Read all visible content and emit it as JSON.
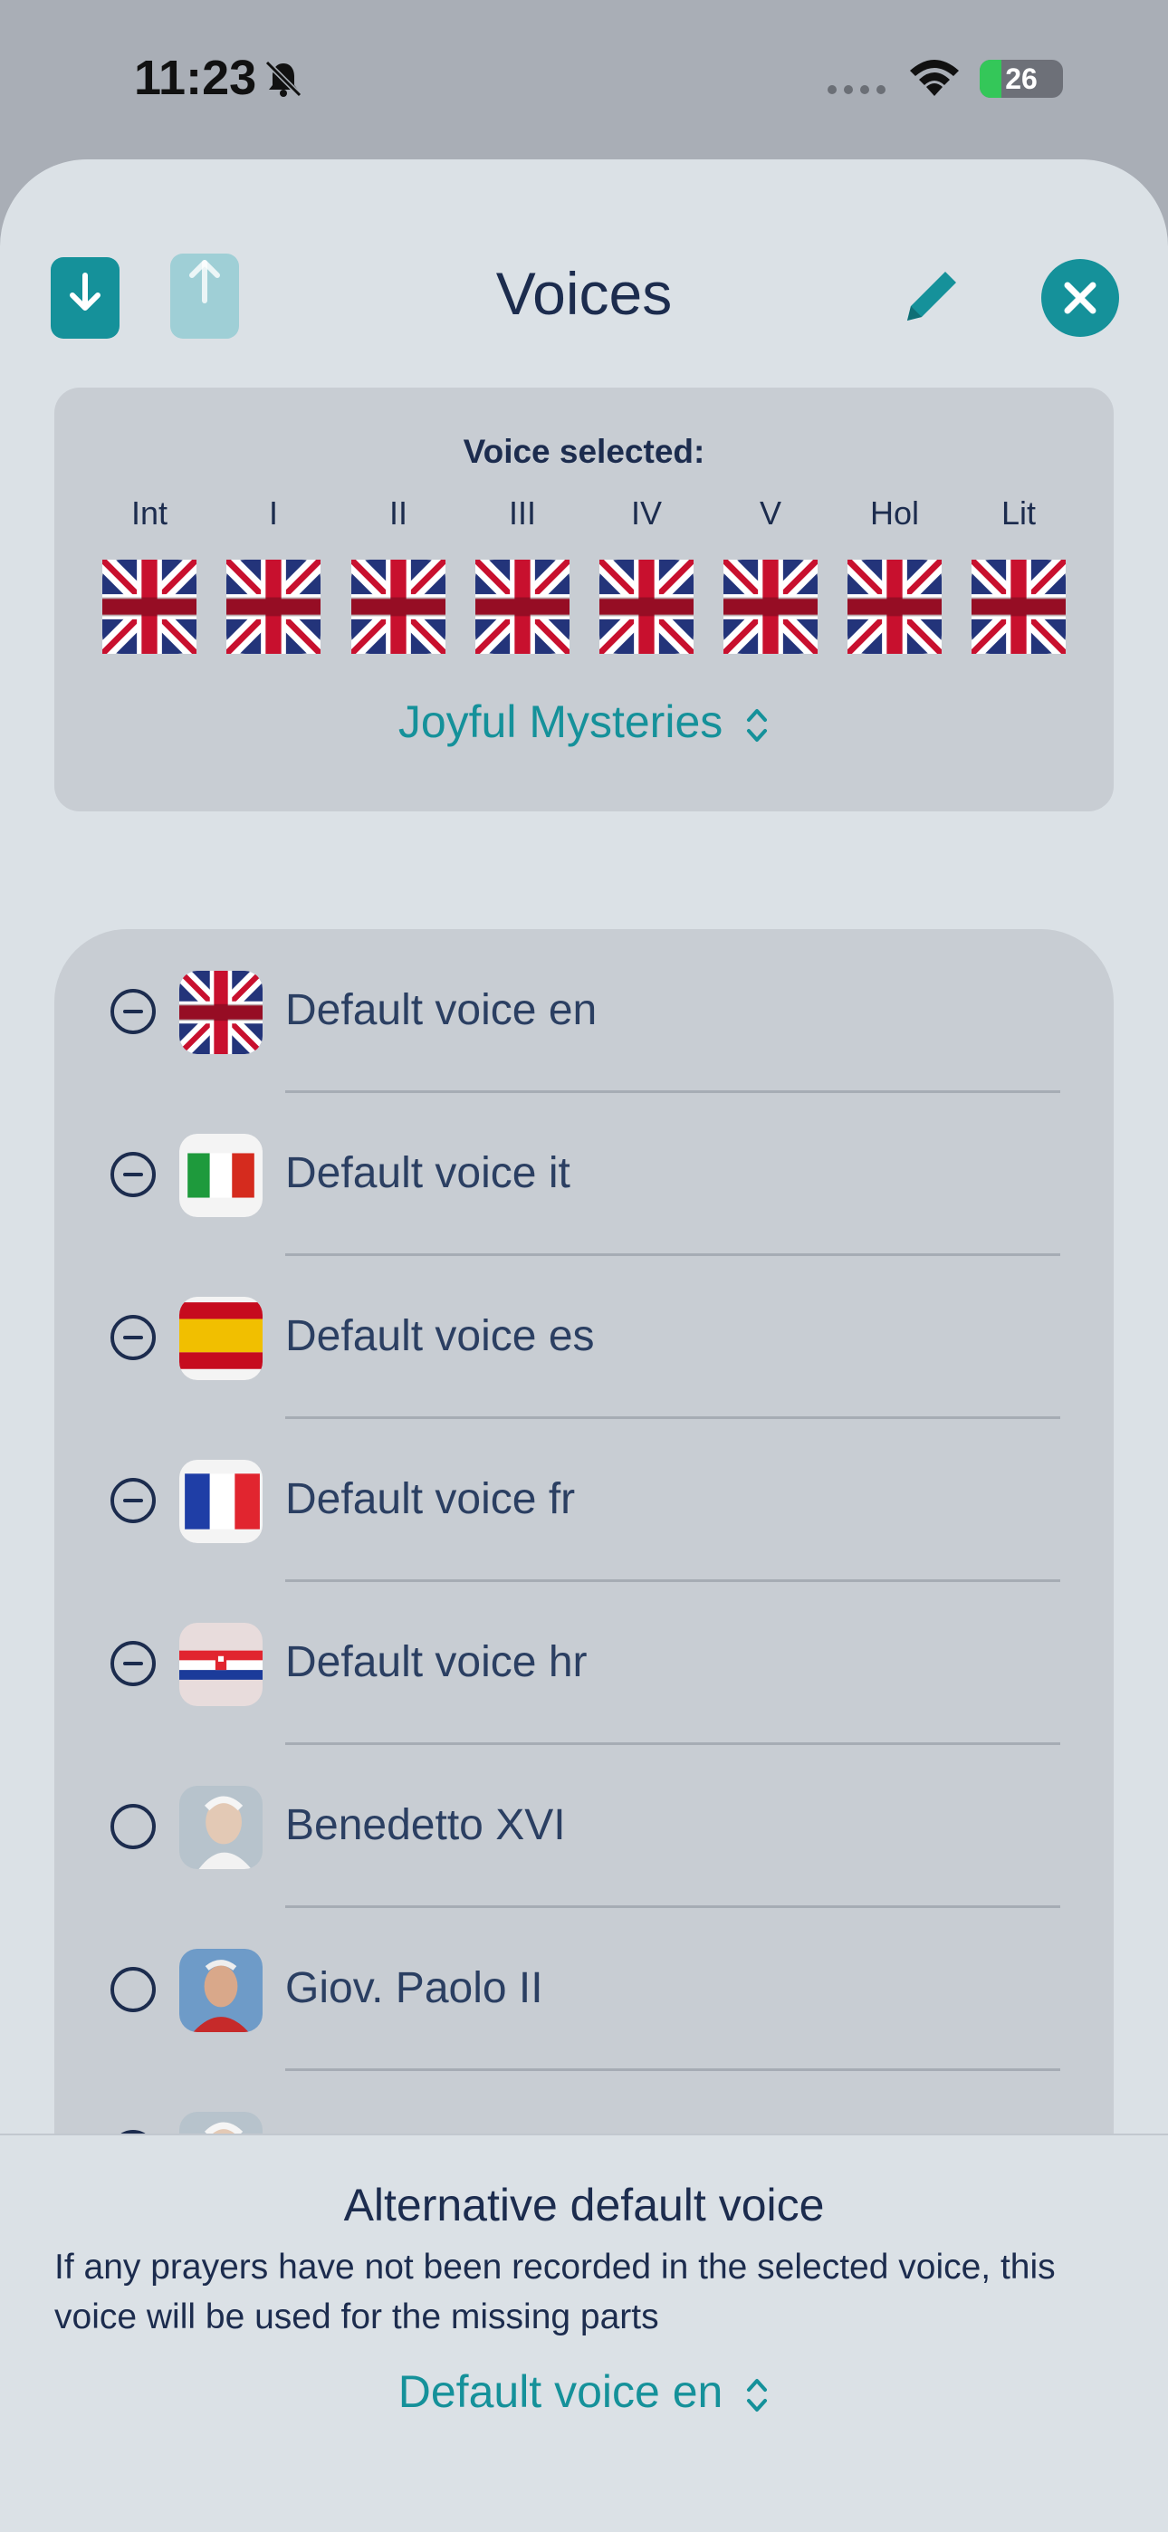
{
  "status_bar": {
    "time": "11:23",
    "battery": "26",
    "battery_level": 0.26
  },
  "header": {
    "title": "Voices",
    "download_icon": "download-icon",
    "share_icon": "share-icon",
    "edit_icon": "pencil-icon",
    "close_icon": "close-icon"
  },
  "selected": {
    "heading": "Voice selected:",
    "slots": [
      {
        "label": "Int",
        "flag": "uk-flag-icon"
      },
      {
        "label": "I",
        "flag": "uk-flag-icon"
      },
      {
        "label": "II",
        "flag": "uk-flag-icon"
      },
      {
        "label": "III",
        "flag": "uk-flag-icon"
      },
      {
        "label": "IV",
        "flag": "uk-flag-icon"
      },
      {
        "label": "V",
        "flag": "uk-flag-icon"
      },
      {
        "label": "Hol",
        "flag": "uk-flag-icon"
      },
      {
        "label": "Lit",
        "flag": "uk-flag-icon"
      }
    ],
    "mysteries": "Joyful Mysteries"
  },
  "voices": [
    {
      "label": "Default voice en",
      "avatar": "uk-flag-icon",
      "control": "remove"
    },
    {
      "label": "Default voice it",
      "avatar": "italy-flag-icon",
      "control": "remove"
    },
    {
      "label": "Default voice es",
      "avatar": "spain-flag-icon",
      "control": "remove"
    },
    {
      "label": "Default voice fr",
      "avatar": "france-flag-icon",
      "control": "remove"
    },
    {
      "label": "Default voice hr",
      "avatar": "croatia-flag-icon",
      "control": "remove"
    },
    {
      "label": "Benedetto XVI",
      "avatar": "portrait-photo",
      "control": "select"
    },
    {
      "label": "Giov. Paolo II",
      "avatar": "portrait-photo",
      "control": "select"
    }
  ],
  "footer": {
    "title": "Alternative default voice",
    "description": "If any prayers have not been recorded in the selected voice, this voice will be used for the missing parts",
    "selected_voice": "Default voice en"
  },
  "colors": {
    "accent": "#15919a",
    "text": "#1c2c4e"
  }
}
